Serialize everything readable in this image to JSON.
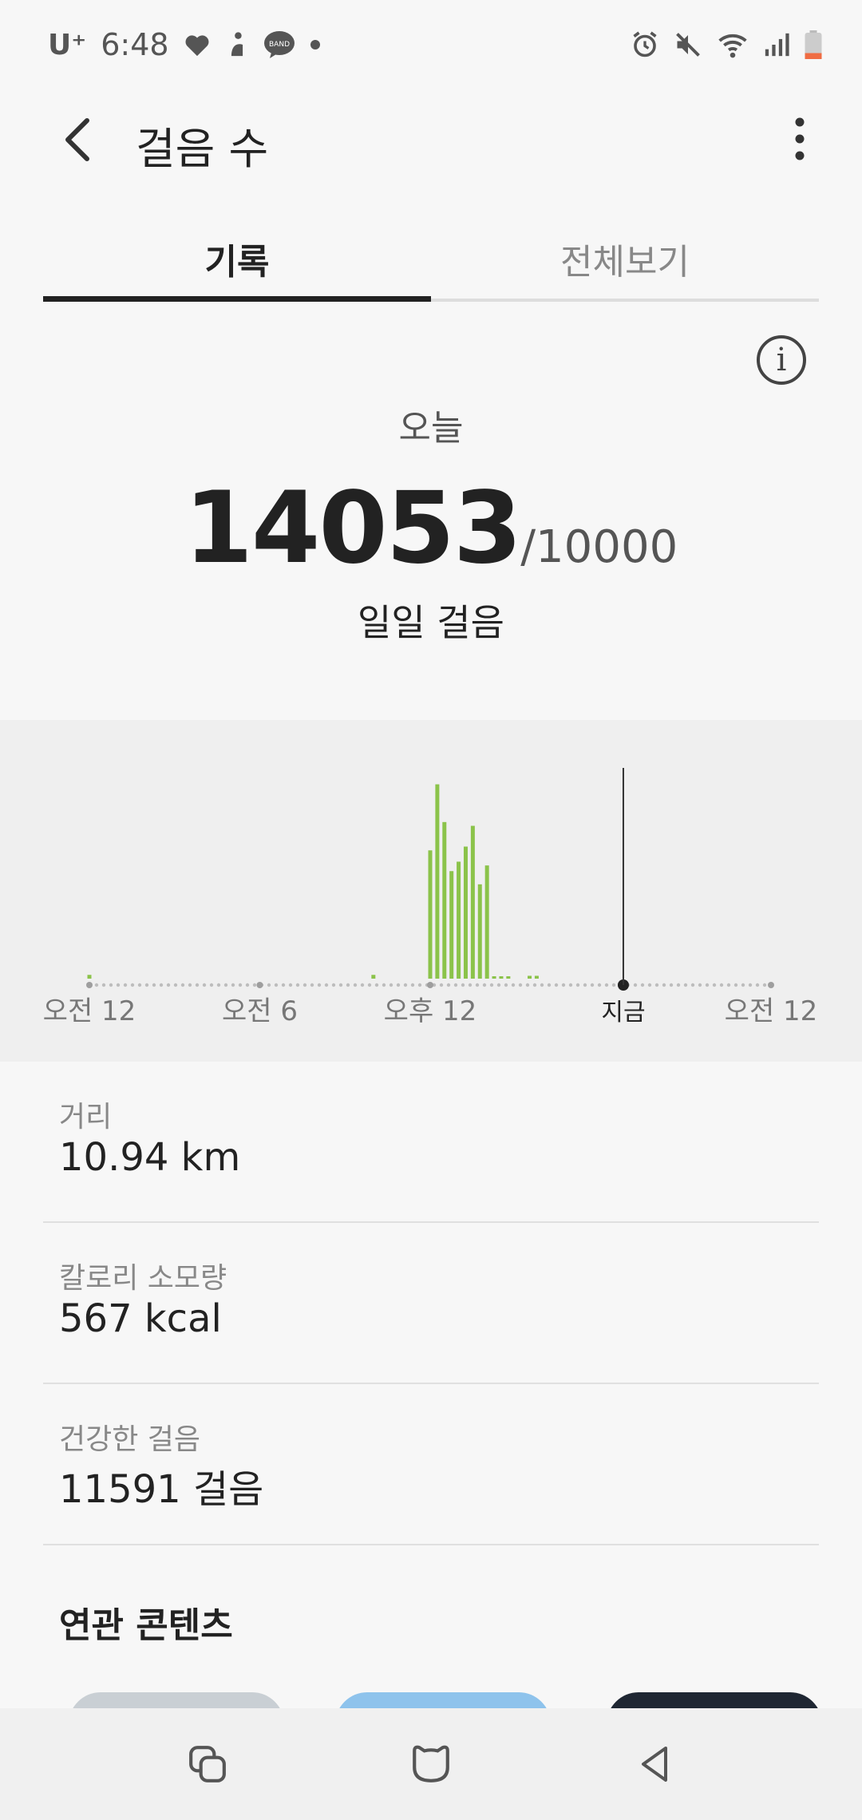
{
  "status_bar": {
    "carrier": "U⁺",
    "time": "6:48",
    "left_icons": [
      "heart-icon",
      "activity-icon",
      "band-icon",
      "dot-icon"
    ],
    "band_label": "BAND",
    "right_icons": [
      "alarm-icon",
      "mute-icon",
      "wifi-icon",
      "signal-icon",
      "battery-icon"
    ]
  },
  "app_bar": {
    "title": "걸음 수",
    "back_icon": "back-arrow-icon",
    "more_icon": "more-vert-icon"
  },
  "tabs": [
    {
      "label": "기록",
      "active": true
    },
    {
      "label": "전체보기",
      "active": false
    }
  ],
  "summary": {
    "info_icon": "info-icon",
    "info_glyph": "i",
    "period": "오늘",
    "steps": "14053",
    "goal": "/10000",
    "caption": "일일 걸음"
  },
  "chart_data": {
    "type": "bar",
    "x_labels": [
      "오전 12",
      "오전 6",
      "오후 12",
      "지금",
      "오전 12"
    ],
    "now_label": "지금",
    "x": [
      "00:00",
      "00:30",
      "10:00",
      "11:30",
      "11:45",
      "12:00",
      "12:15",
      "12:30",
      "12:45",
      "13:00",
      "13:15",
      "13:30",
      "13:45",
      "14:00",
      "14:15",
      "14:30",
      "14:45",
      "15:30",
      "15:45"
    ],
    "values": [
      20,
      0,
      20,
      0,
      0,
      680,
      1030,
      830,
      570,
      620,
      700,
      810,
      500,
      600,
      10,
      10,
      10,
      15,
      15
    ],
    "bar_color": "#8bc34a",
    "now_time": "18:48",
    "x_range": [
      "00:00",
      "24:00"
    ]
  },
  "stats": [
    {
      "label": "거리",
      "value": "10.94 km"
    },
    {
      "label": "칼로리 소모량",
      "value": "567 kcal"
    },
    {
      "label": "건강한 걸음",
      "value": "11591 걸음"
    }
  ],
  "related": {
    "title": "연관 콘텐츠"
  },
  "nav_bar": {
    "icons": [
      "recent-apps-icon",
      "home-icon",
      "back-icon"
    ]
  }
}
